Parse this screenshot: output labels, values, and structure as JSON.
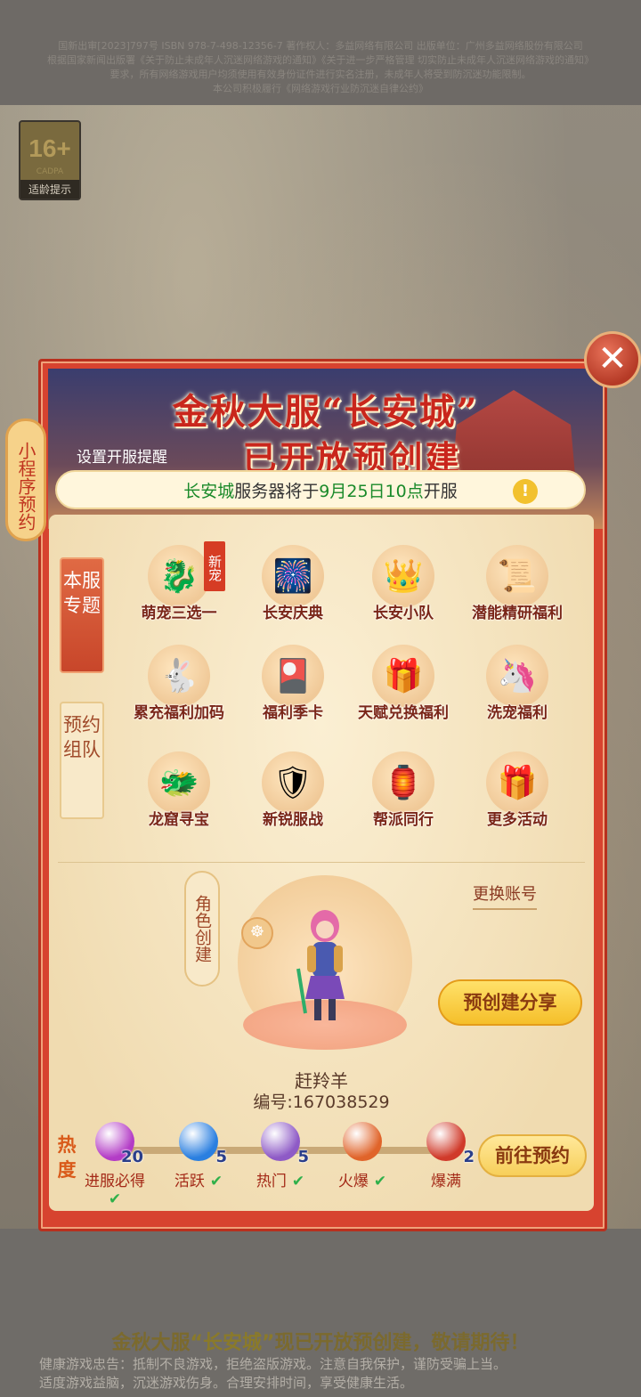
{
  "license": {
    "line1": "国新出审[2023]797号  ISBN 978-7-498-12356-7  著作权人：多益网络有限公司 出版单位：广州多益网络股份有限公司",
    "line2": "根据国家新闻出版署《关于防止未成年人沉迷网络游戏的通知》《关于进一步严格管理 切实防止未成年人沉迷网络游戏的通知》",
    "line3": "要求，所有网络游戏用户均须使用有效身份证件进行实名注册，未成年人将受到防沉迷功能限制。",
    "line4": "本公司积极履行《网络游戏行业防沉迷自律公约》"
  },
  "age_badge": {
    "rating": "16+",
    "org": "CADPA",
    "tip": "适龄提示"
  },
  "side_tag": {
    "label": "小程序预约"
  },
  "modal": {
    "title_line1": "金秋大服“长安城”",
    "title_line2": "已开放预创建",
    "remind_link": "设置开服提醒",
    "close_symbol": "✕",
    "notice": {
      "city": "长安城",
      "mid": "服务器将于",
      "time": "9月25日10点",
      "tail": "开服",
      "warn_symbol": "!"
    },
    "tabs": [
      {
        "label": "本服专题"
      },
      {
        "label": "预约组队"
      }
    ],
    "activities": [
      {
        "label": "萌宠三选一",
        "icon": "pets-icon",
        "emoji": "🐉",
        "badge": "新宠"
      },
      {
        "label": "长安庆典",
        "icon": "firework-icon",
        "emoji": "🎆"
      },
      {
        "label": "长安小队",
        "icon": "crown-icon",
        "emoji": "👑"
      },
      {
        "label": "潜能精研福利",
        "icon": "scroll-icon",
        "emoji": "📜"
      },
      {
        "label": "累充福利加码",
        "icon": "rabbit-icon",
        "emoji": "🐇"
      },
      {
        "label": "福利季卡",
        "icon": "card-icon",
        "emoji": "🎴"
      },
      {
        "label": "天赋兑换福利",
        "icon": "exchange-icon",
        "emoji": "🎁"
      },
      {
        "label": "洗宠福利",
        "icon": "spirit-icon",
        "emoji": "🦄"
      },
      {
        "label": "龙窟寻宝",
        "icon": "dragon-icon",
        "emoji": "🐲"
      },
      {
        "label": "新锐服战",
        "icon": "helmet-icon",
        "emoji": "🛡"
      },
      {
        "label": "帮派同行",
        "icon": "banner-icon",
        "emoji": "🏮"
      },
      {
        "label": "更多活动",
        "icon": "gift-icon",
        "emoji": "🎁"
      }
    ],
    "role": {
      "tag": "角色创建",
      "switch_account": "更换账号",
      "share_button": "预创建分享",
      "name": "赶羚羊",
      "id": "编号:167038529"
    },
    "heat": {
      "label": "热度",
      "go_button": "前往预约",
      "levels": [
        {
          "name": "进服必得",
          "count": "20",
          "checked": true,
          "color": "#b33cc6"
        },
        {
          "name": "活跃",
          "count": "5",
          "checked": true,
          "color": "#2a7fe0"
        },
        {
          "name": "热门",
          "count": "5",
          "checked": true,
          "color": "#8e5ac6"
        },
        {
          "name": "火爆",
          "count": "",
          "checked": true,
          "color": "#e0642a"
        },
        {
          "name": "爆满",
          "count": "2",
          "checked": false,
          "color": "#d03a2a"
        }
      ]
    }
  },
  "bottom": {
    "slogan_pre": "金秋大服",
    "slogan_hl": "“长安城”",
    "slogan_post": "现已开放预创建，敬请期待！",
    "health_line1": "健康游戏忠告：抵制不良游戏，拒绝盗版游戏。注意自我保护，谨防受骗上当。",
    "health_line2": "适度游戏益脑，沉迷游戏伤身。合理安排时间，享受健康生活。"
  }
}
